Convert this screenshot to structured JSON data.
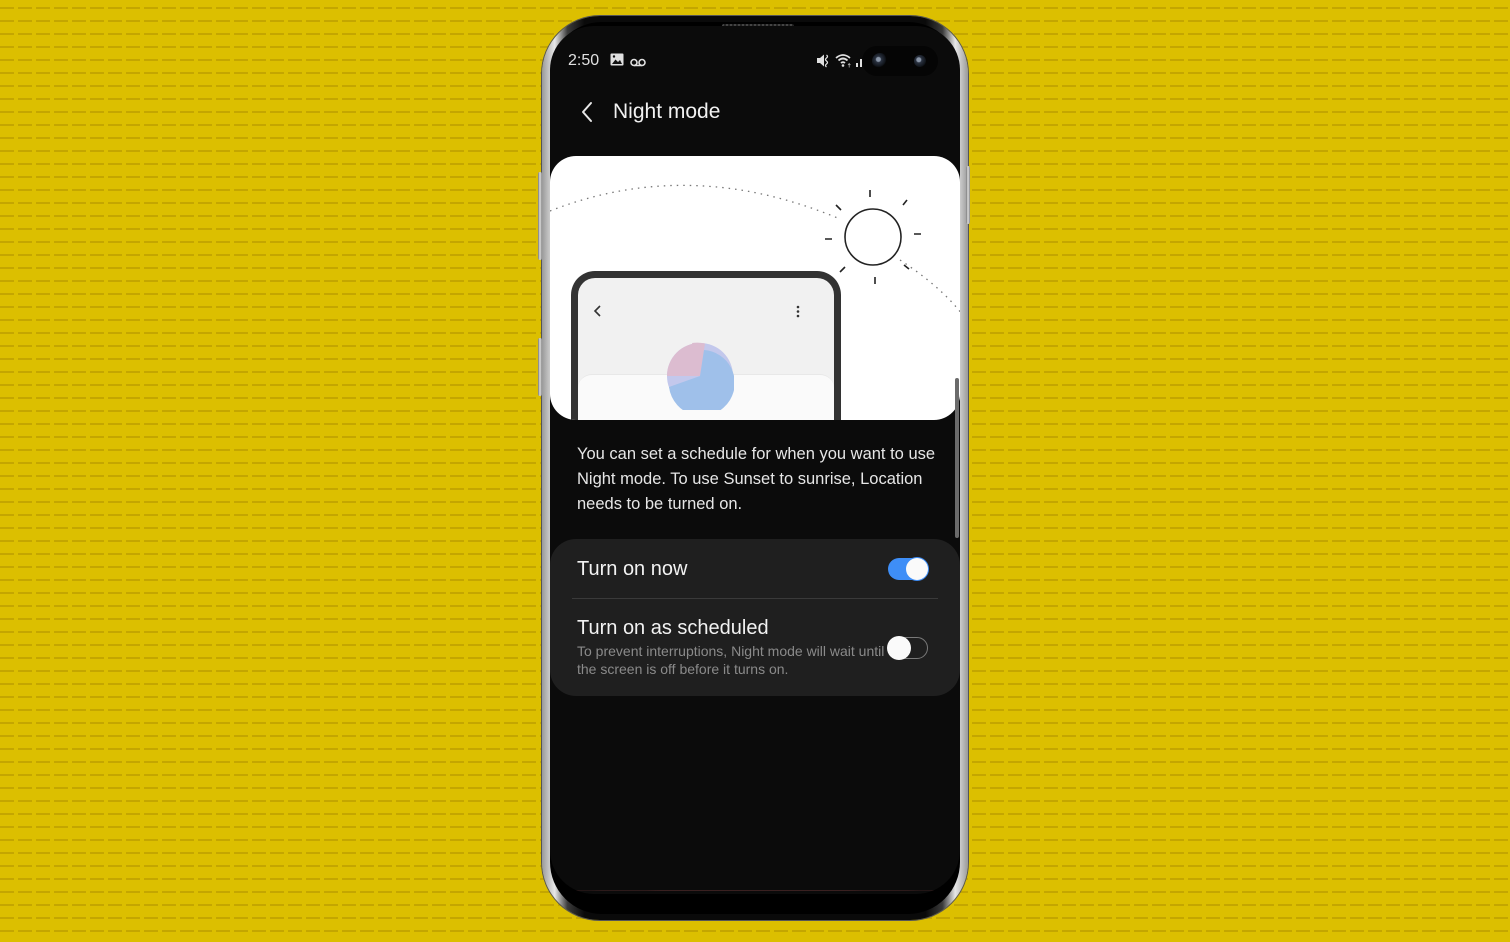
{
  "status_bar": {
    "time": "2:50",
    "left_icons": [
      "image-icon",
      "voicemail-icon"
    ],
    "right_icons": [
      "mute-icon",
      "wifi-icon",
      "signal-icon"
    ]
  },
  "header": {
    "back_icon": "chevron-left-icon",
    "title": "Night mode"
  },
  "illustration": {
    "description": "Sun over dotted arc with phone preview",
    "mini_phone_icons": [
      "chevron-left-icon",
      "more-vertical-icon"
    ],
    "colors": {
      "pie_pink": "#dcbcd0",
      "pie_blue": "#9fc0ea",
      "pie_lavender": "#c3c8ec"
    }
  },
  "description": "You can set a schedule for when you want to use Night mode. To use Sunset to sunrise, Location needs to be turned on.",
  "settings": [
    {
      "title": "Turn on now",
      "subtitle": "",
      "enabled": true
    },
    {
      "title": "Turn on as scheduled",
      "subtitle": "To prevent interruptions, Night mode will wait until the screen is off before it turns on.",
      "enabled": false
    }
  ],
  "colors": {
    "background": "#dcbf00",
    "screen": "#0b0b0b",
    "card": "#1f1f1f",
    "toggle_on": "#3e8ef7"
  }
}
